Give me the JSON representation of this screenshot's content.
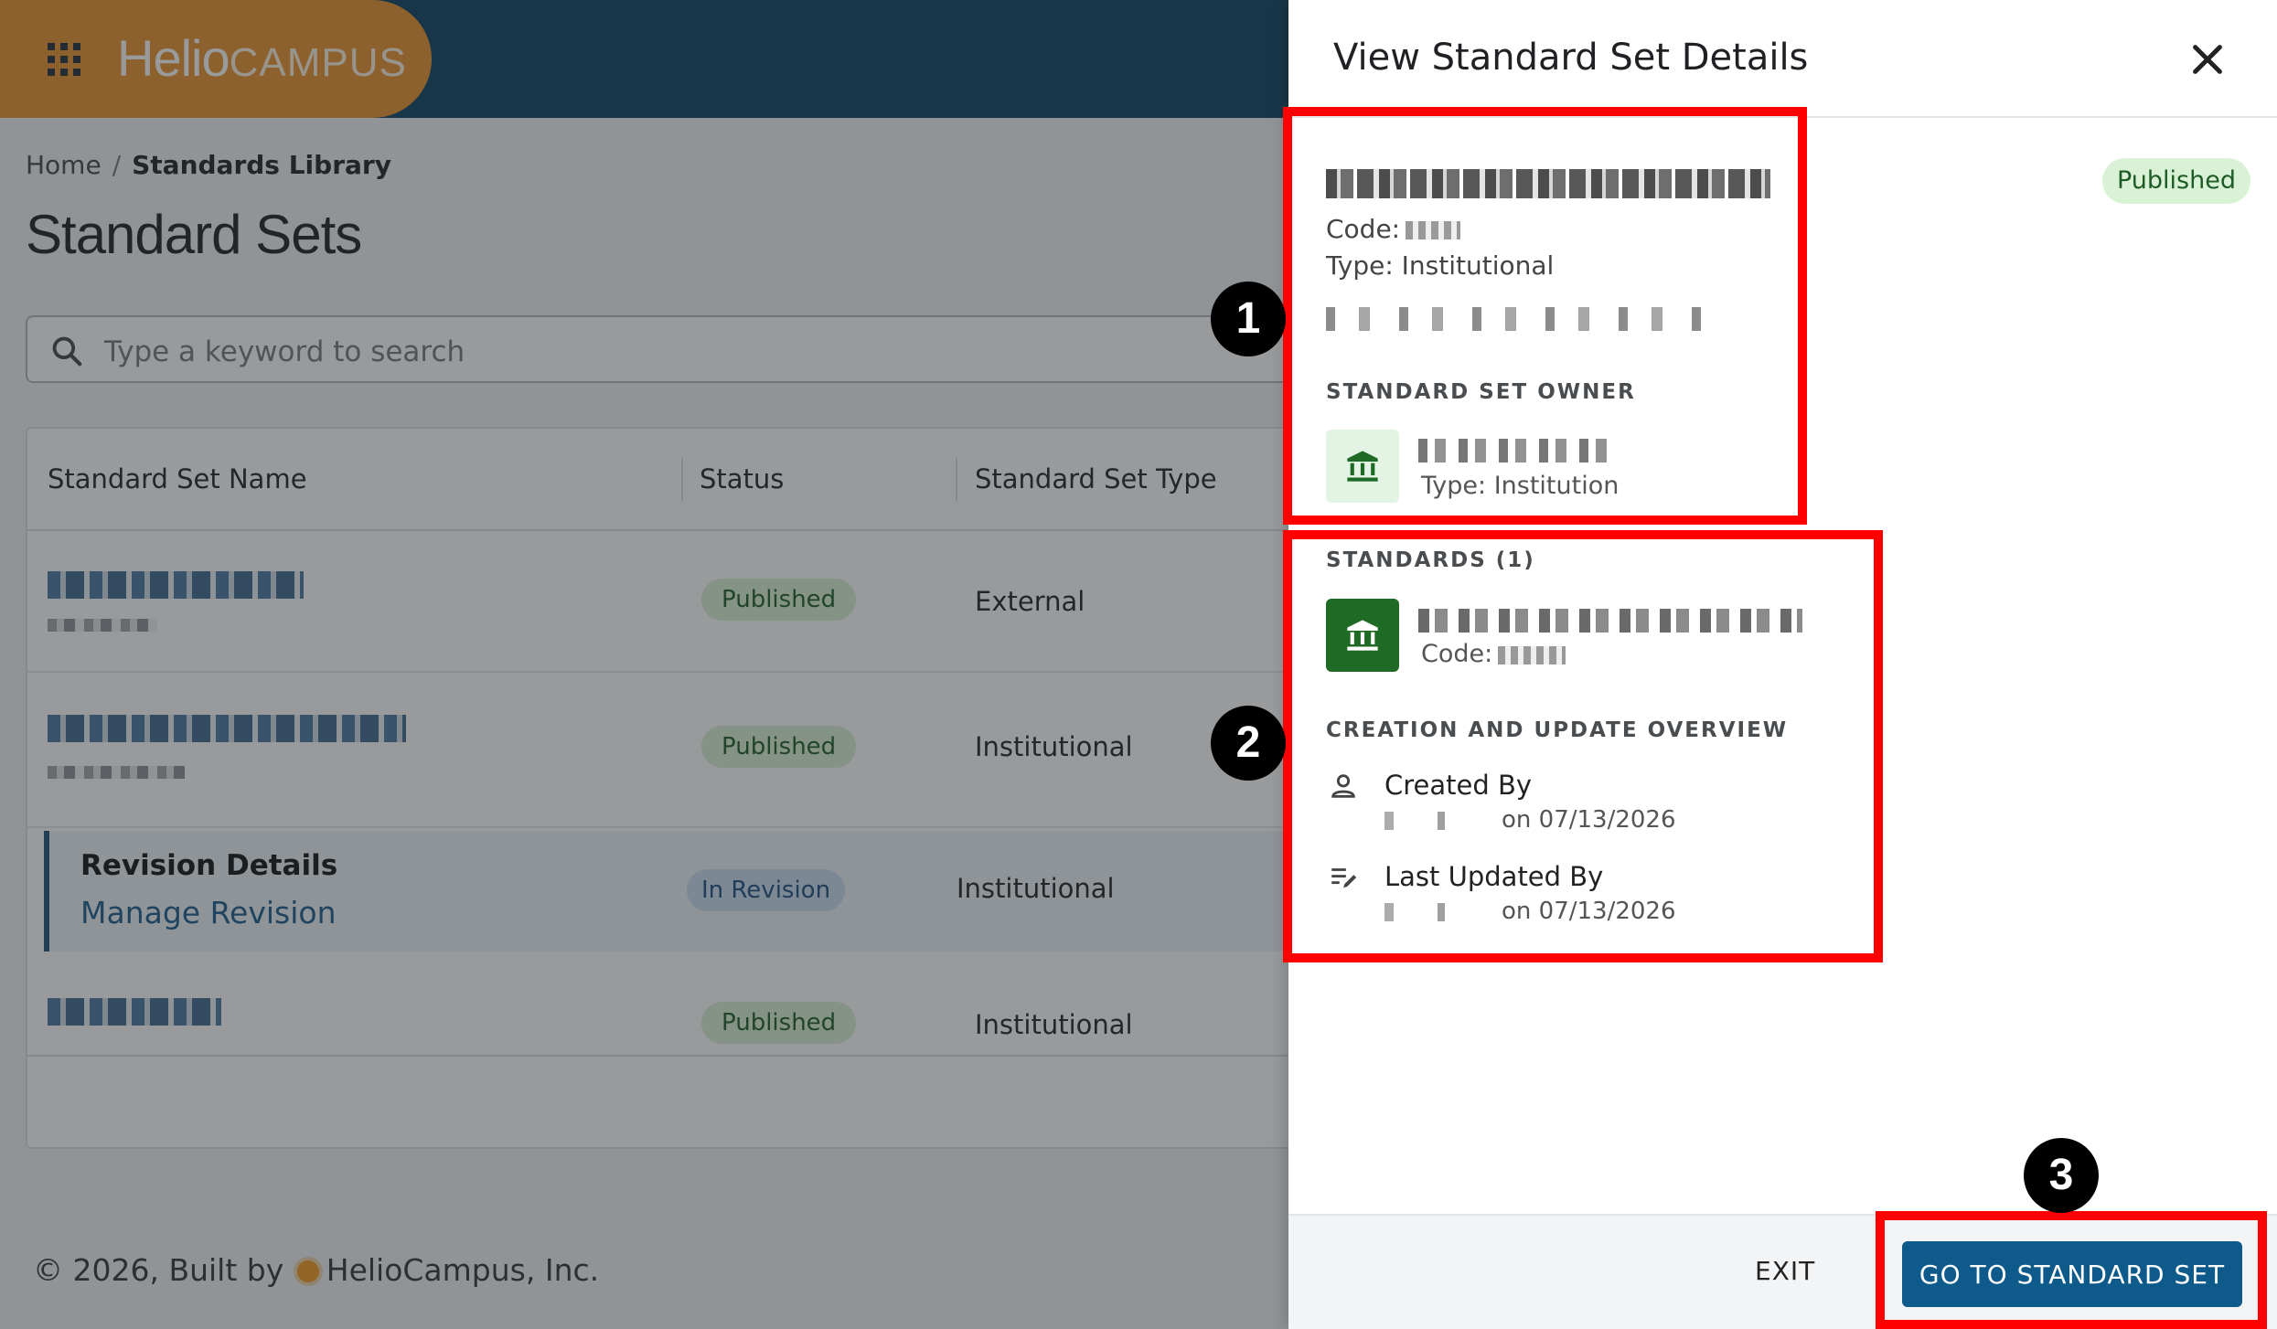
{
  "app": {
    "brand": {
      "part1": "Helio",
      "part2": "CAMPUS"
    },
    "breadcrumb": {
      "home": "Home",
      "separator": "/",
      "current": "Standards Library"
    },
    "page_title": "Standard Sets",
    "search": {
      "placeholder": "Type a keyword to search"
    },
    "table": {
      "headers": {
        "name": "Standard Set Name",
        "status": "Status",
        "type": "Standard Set Type"
      },
      "rows": [
        {
          "status": "Published",
          "type": "External"
        },
        {
          "status": "Published",
          "type": "Institutional"
        },
        {
          "title": "Revision Details",
          "link": "Manage Revision",
          "status": "In Revision",
          "type": "Institutional"
        },
        {
          "status": "Published",
          "type": "Institutional"
        }
      ]
    },
    "footer": {
      "prefix": "© 2026, Built by",
      "company": "HelioCampus, Inc."
    }
  },
  "drawer": {
    "title": "View Standard Set Details",
    "status_badge": "Published",
    "code_label": "Code:",
    "type_line": "Type: Institutional",
    "owner_section": "STANDARD SET OWNER",
    "owner_type": "Type: Institution",
    "standards_section": "STANDARDS (1)",
    "standard_code_label": "Code:",
    "overview_section": "CREATION AND UPDATE OVERVIEW",
    "created_by_label": "Created By",
    "created_on": "on 07/13/2026",
    "updated_by_label": "Last Updated By",
    "updated_on": "on 07/13/2026",
    "exit_label": "EXIT",
    "go_label": "GO TO STANDARD SET"
  },
  "annotations": {
    "markers": [
      "1",
      "2",
      "3"
    ],
    "highlight_color": "#ff0000"
  },
  "colors": {
    "topbar": "#0a4061",
    "brand": "#e8932d",
    "primary_button": "#0e5a8a",
    "published_badge": "#d9f2d5",
    "owner_icon_bg": "#e3f3e4",
    "standard_icon_bg": "#1f6a24"
  },
  "icons": {
    "apps": "apps-grid-icon",
    "search": "search-icon",
    "close": "close-icon",
    "institution": "institution-icon",
    "person": "person-icon",
    "edit": "edit-icon"
  }
}
